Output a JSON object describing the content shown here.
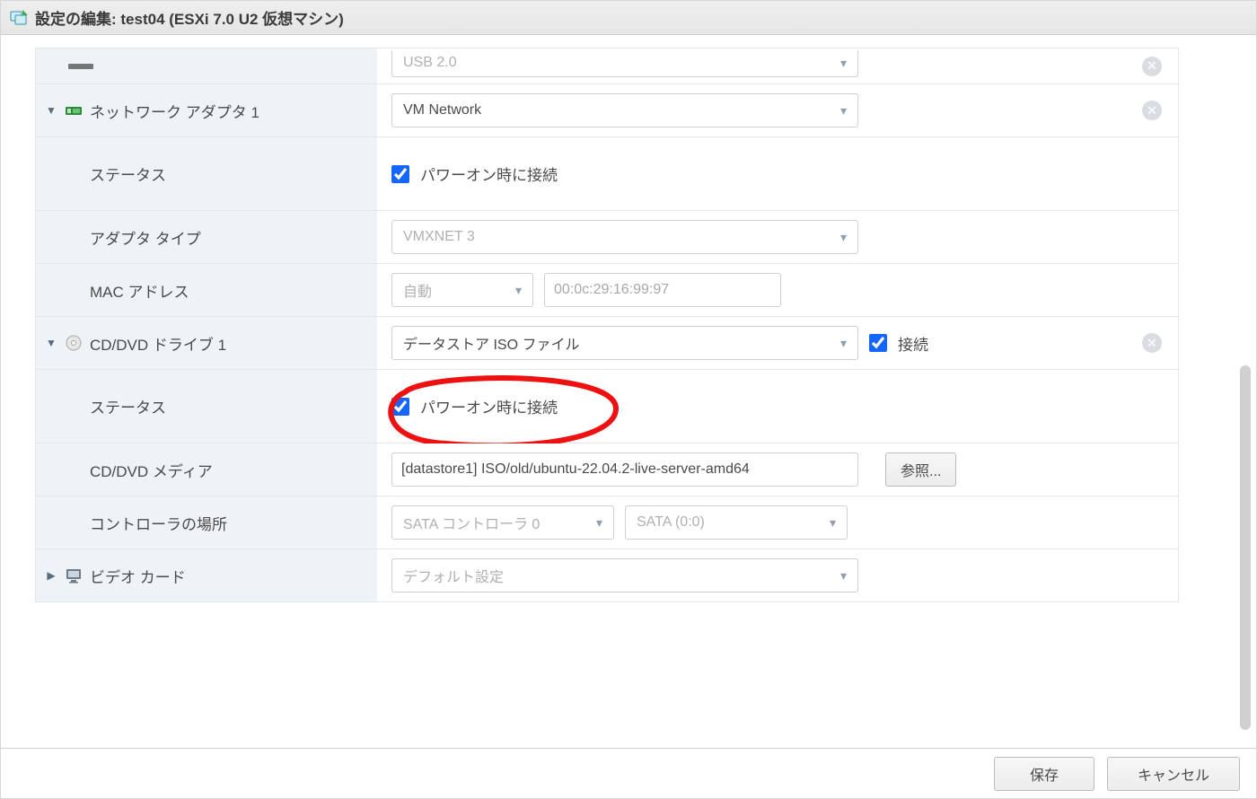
{
  "title": "設定の編集: test04 (ESXi 7.0 U2 仮想マシン)",
  "usb": {
    "select": "USB 2.0"
  },
  "nic": {
    "label": "ネットワーク アダプタ 1",
    "network": "VM Network",
    "status_label": "ステータス",
    "connect_on_power": "パワーオン時に接続",
    "adapter_type_label": "アダプタ タイプ",
    "adapter_type": "VMXNET 3",
    "mac_label": "MAC アドレス",
    "mac_mode": "自動",
    "mac_value": "00:0c:29:16:99:97"
  },
  "cd": {
    "label": "CD/DVD ドライブ 1",
    "type": "データストア ISO ファイル",
    "connect": "接続",
    "status_label": "ステータス",
    "connect_on_power": "パワーオン時に接続",
    "media_label": "CD/DVD メディア",
    "media_path": "[datastore1] ISO/old/ubuntu-22.04.2-live-server-amd64",
    "browse": "参照...",
    "controller_label": "コントローラの場所",
    "controller": "SATA コントローラ 0",
    "slot": "SATA (0:0)"
  },
  "video": {
    "label": "ビデオ カード",
    "value": "デフォルト設定"
  },
  "footer": {
    "save": "保存",
    "cancel": "キャンセル"
  }
}
